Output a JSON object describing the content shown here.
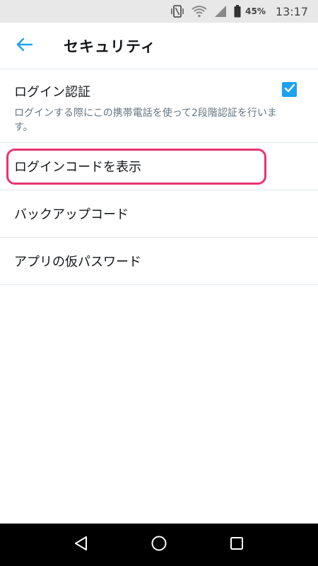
{
  "status_bar": {
    "battery_percent": "45%",
    "time": "13:17",
    "icons": [
      "vibrate-icon",
      "wifi-icon",
      "signal-icon",
      "battery-icon"
    ]
  },
  "app_bar": {
    "back_icon": "arrow-left-icon",
    "title": "セキュリティ"
  },
  "settings": {
    "login_auth": {
      "title": "ログイン認証",
      "description": "ログインする際にこの携帯電話を使って2段階認証を行います。",
      "checked": true
    },
    "items": [
      {
        "label": "ログインコードを表示",
        "highlighted": true
      },
      {
        "label": "バックアップコード"
      },
      {
        "label": "アプリの仮パスワード"
      }
    ]
  },
  "nav_bar": {
    "icons": [
      "back-triangle-icon",
      "home-circle-icon",
      "recents-square-icon"
    ]
  },
  "colors": {
    "accent": "#1da1f2",
    "highlight": "#e8346f",
    "divider": "#e1e8ed",
    "secondary_text": "#657786"
  }
}
